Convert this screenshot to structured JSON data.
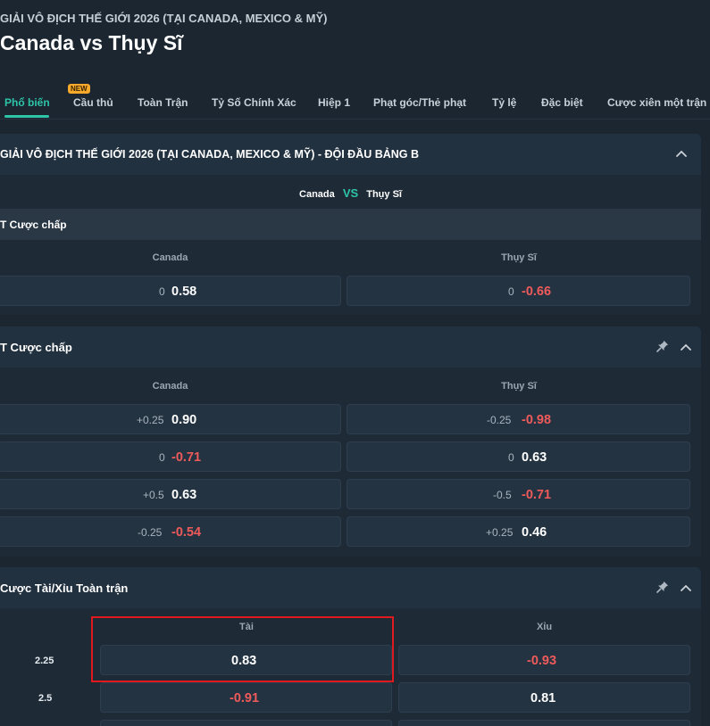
{
  "header": {
    "league": "GIẢI VÔ ĐỊCH THẾ GIỚI 2026 (TẠI CANADA, MEXICO & MỸ)",
    "title": "Canada vs Thụy Sĩ"
  },
  "tabs": [
    {
      "label": "Phổ biến",
      "active": true
    },
    {
      "label": "Cầu thủ",
      "badge": "NEW"
    },
    {
      "label": "Toàn Trận"
    },
    {
      "label": "Tỷ Số Chính Xác"
    },
    {
      "label": "Hiệp 1"
    },
    {
      "label": "Phạt góc/Thẻ phạt"
    },
    {
      "label": "Tỷ lệ"
    },
    {
      "label": "Đặc biệt"
    },
    {
      "label": "Cược xiên một trận"
    }
  ],
  "group": {
    "title": "GIẢI VÔ ĐỊCH THẾ GIỚI 2026 (TẠI CANADA, MEXICO & MỸ) - ĐỘI ĐẦU BẢNG B",
    "home": "Canada",
    "vs": "VS",
    "away": "Thụy Sĩ",
    "market_label": "T Cược chấp",
    "col_home": "Canada",
    "col_away": "Thụy Sĩ",
    "odds": {
      "home": {
        "hcp": "0",
        "val": "0.58"
      },
      "away": {
        "hcp": "0",
        "val": "-0.66"
      }
    }
  },
  "handicap": {
    "title": "T Cược chấp",
    "col_home": "Canada",
    "col_away": "Thụy Sĩ",
    "rows": [
      {
        "home_hcp": "+0.25",
        "home_val": "0.90",
        "away_hcp": "-0.25",
        "away_val": "-0.98"
      },
      {
        "home_hcp": "0",
        "home_val": "-0.71",
        "away_hcp": "0",
        "away_val": "0.63"
      },
      {
        "home_hcp": "+0.5",
        "home_val": "0.63",
        "away_hcp": "-0.5",
        "away_val": "-0.71"
      },
      {
        "home_hcp": "-0.25",
        "home_val": "-0.54",
        "away_hcp": "+0.25",
        "away_val": "0.46"
      }
    ]
  },
  "overunder": {
    "title": "Cược Tài/Xỉu Toàn trận",
    "col_over": "Tài",
    "col_under": "Xỉu",
    "rows": [
      {
        "line": "2.25",
        "over": "0.83",
        "under": "-0.93"
      },
      {
        "line": "2.5",
        "over": "-0.91",
        "under": "0.81"
      }
    ]
  },
  "colors": {
    "accent": "#2ec4a8",
    "negative": "#ef5a5a",
    "highlight": "#e0191e",
    "badge": "#f6a92a"
  },
  "icons": [
    "chevron-up-icon",
    "pin-icon"
  ]
}
